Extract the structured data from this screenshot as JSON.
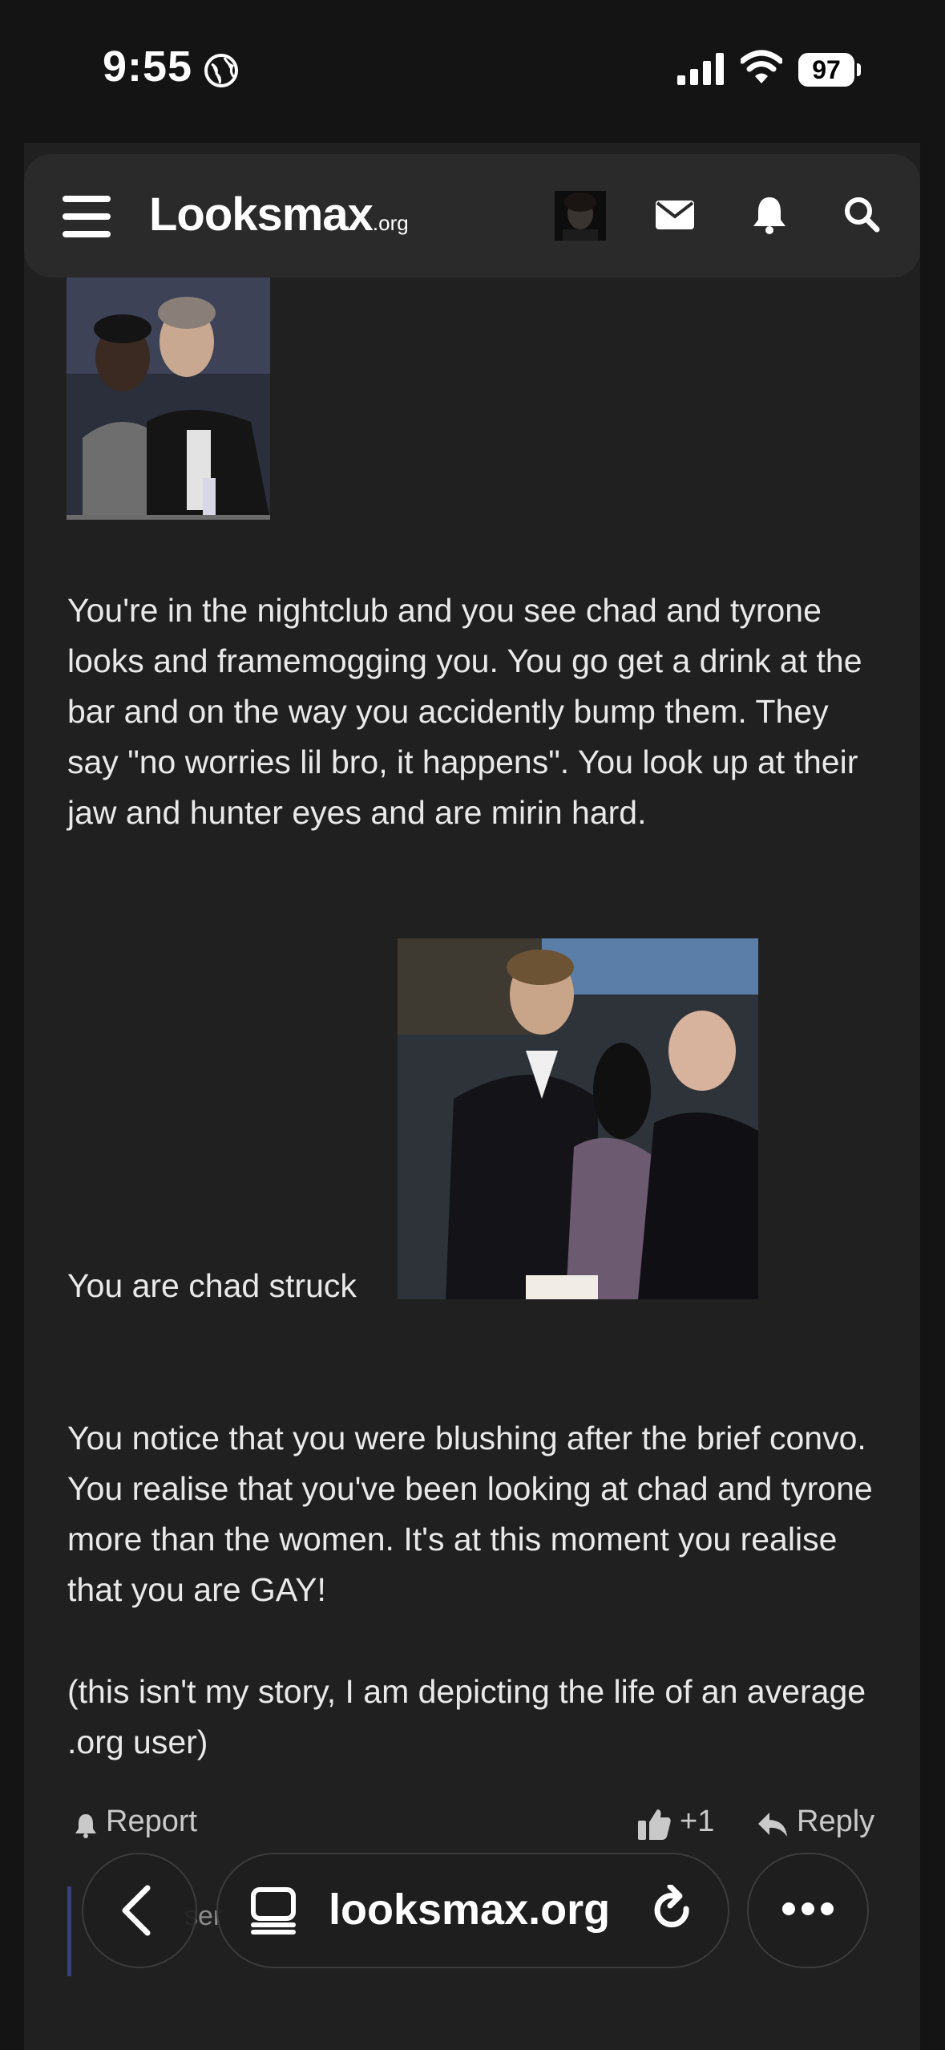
{
  "status_bar": {
    "time": "9:55",
    "battery": "97"
  },
  "header": {
    "logo_main": "Looksmax",
    "logo_suffix": ".org",
    "icons": [
      "menu-icon",
      "avatar",
      "mail-icon",
      "bell-icon",
      "search-icon"
    ]
  },
  "post": {
    "paragraph_1": "You're in the nightclub and you see chad and tyrone looks and framemogging you. You go get a drink at the bar and on the way you accidently bump them. They say \"no worries lil bro, it happens\". You look up at their jaw and hunter eyes and are mirin hard.",
    "caption": "You are chad struck",
    "paragraph_2": "You notice that you were blushing after the brief convo. You realise that you've been looking at chad and tyrone more than the women. It's at this moment you realise that you are GAY!",
    "paragraph_3": "(this isn't my story, I am depicting the life of an average .org user)"
  },
  "actions": {
    "report": "Report",
    "like_count": "+1",
    "reply": "Reply"
  },
  "quote_preview": "ser",
  "browser_bar": {
    "url": "looksmax.org"
  },
  "colors": {
    "background": "#141414",
    "panel": "#202020",
    "header": "#2a2a2b",
    "text": "#e9e9e9"
  }
}
